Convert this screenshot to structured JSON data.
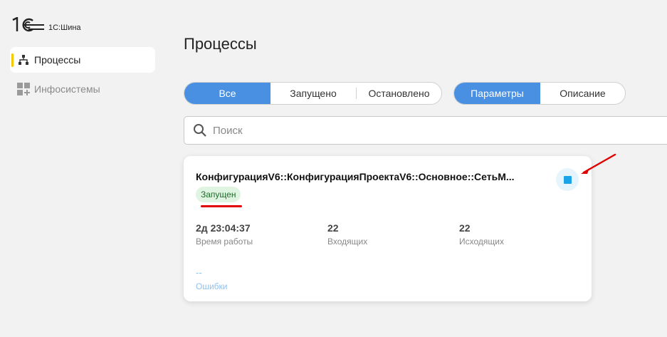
{
  "app": {
    "logo_text": "1С:Шина"
  },
  "sidebar": {
    "items": [
      {
        "label": "Процессы",
        "icon": "hierarchy-icon",
        "active": true
      },
      {
        "label": "Инфосистемы",
        "icon": "grid-plus-icon",
        "active": false
      }
    ],
    "accent": "#f5c800"
  },
  "main": {
    "title": "Процессы",
    "status_filter": {
      "options": [
        "Все",
        "Запущено",
        "Остановлено"
      ],
      "selected": "Все"
    },
    "view_filter": {
      "options": [
        "Параметры",
        "Описание"
      ],
      "selected": "Параметры"
    },
    "search": {
      "placeholder": "Поиск",
      "value": ""
    },
    "process_card": {
      "title": "КонфигурацияV6::КонфигурацияПроектаV6::Основное::СетьМ...",
      "status": "Запущен",
      "uptime_value": "2д 23:04:37",
      "uptime_label": "Время работы",
      "incoming_value": "22",
      "incoming_label": "Входящих",
      "outgoing_value": "22",
      "outgoing_label": "Исходящих",
      "errors_value": "--",
      "errors_label": "Ошибки"
    }
  },
  "colors": {
    "accent_blue": "#4a90e2",
    "status_bg": "#dff5e1",
    "status_text": "#1f6b2a",
    "stop_icon": "#1aa3e8",
    "annotation_red": "#e00000"
  }
}
